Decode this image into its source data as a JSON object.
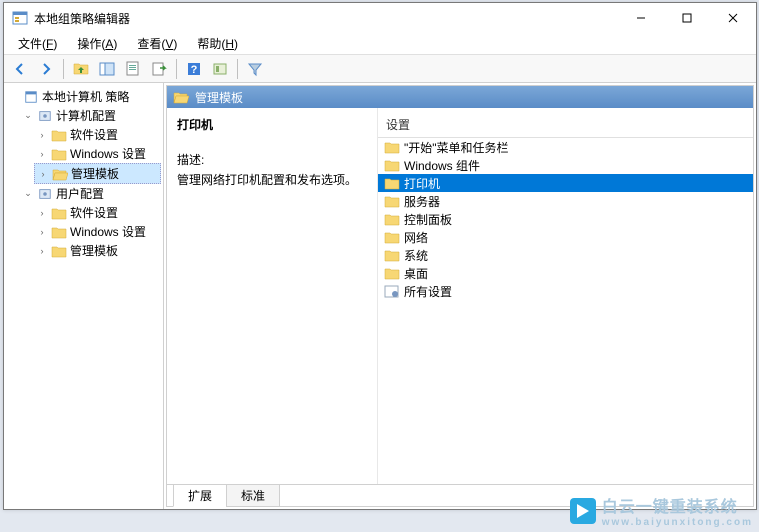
{
  "titlebar": {
    "title": "本地组策略编辑器"
  },
  "menubar": [
    {
      "label": "文件",
      "key": "F"
    },
    {
      "label": "操作",
      "key": "A"
    },
    {
      "label": "查看",
      "key": "V"
    },
    {
      "label": "帮助",
      "key": "H"
    }
  ],
  "tree": {
    "root": {
      "label": "本地计算机 策略"
    },
    "groups": [
      {
        "label": "计算机配置",
        "expanded": true,
        "children": [
          {
            "label": "软件设置"
          },
          {
            "label": "Windows 设置"
          },
          {
            "label": "管理模板",
            "selected": true
          }
        ]
      },
      {
        "label": "用户配置",
        "expanded": true,
        "children": [
          {
            "label": "软件设置"
          },
          {
            "label": "Windows 设置"
          },
          {
            "label": "管理模板"
          }
        ]
      }
    ]
  },
  "detail": {
    "header": "管理模板",
    "title": "打印机",
    "desc_label": "描述:",
    "desc_text": "管理网络打印机配置和发布选项。",
    "list_header": "设置",
    "items": [
      {
        "label": "\"开始\"菜单和任务栏",
        "type": "folder"
      },
      {
        "label": "Windows 组件",
        "type": "folder"
      },
      {
        "label": "打印机",
        "type": "folder",
        "selected": true
      },
      {
        "label": "服务器",
        "type": "folder"
      },
      {
        "label": "控制面板",
        "type": "folder"
      },
      {
        "label": "网络",
        "type": "folder"
      },
      {
        "label": "系统",
        "type": "folder"
      },
      {
        "label": "桌面",
        "type": "folder"
      },
      {
        "label": "所有设置",
        "type": "settings"
      }
    ]
  },
  "tabs": [
    {
      "label": "扩展",
      "active": true
    },
    {
      "label": "标准",
      "active": false
    }
  ],
  "watermark": {
    "brand": "白云一键重装系统",
    "url": "www.baiyunxitong.com"
  }
}
